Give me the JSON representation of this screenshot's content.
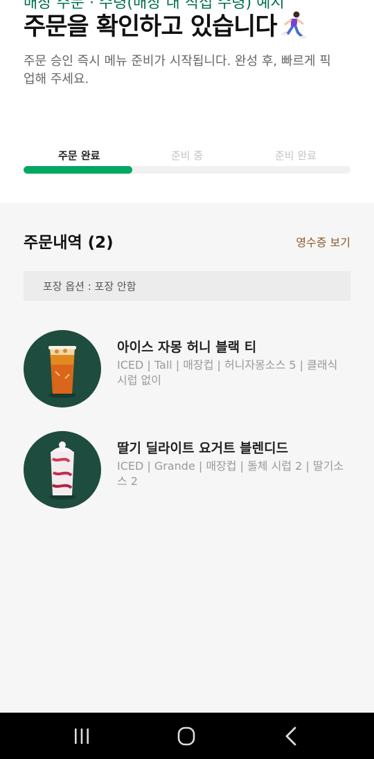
{
  "header": {
    "clipped_text": "매장 주문 · 수령(매장 내 직접 수령) 예시",
    "title": "주문을 확인하고 있습니다",
    "subtitle": "주문 승인 즉시 메뉴 준비가 시작됩니다. 완성 후, 빠르게 픽업해 주세요."
  },
  "progress": {
    "steps": [
      "주문 완료",
      "준비 중",
      "준비 완료"
    ],
    "active_index": 0,
    "fraction": 0.333,
    "accent_color": "#00a862"
  },
  "order": {
    "section_title": "주문내역 (2)",
    "receipt_link": "영수증 보기",
    "pack_option": "포장 옵션 : 포장 안함",
    "items": [
      {
        "name": "아이스 자몽 허니 블랙 티",
        "options": "ICED | Tall | 매장컵 | 허니자몽소스 5 | 클래식 시럽 없이",
        "icon": "iced-grapefruit-tea-image"
      },
      {
        "name": "딸기 딜라이트 요거트 블렌디드",
        "options": "ICED | Grande | 매장컵 | 돌체 시럽 2 | 딸기소스 2",
        "icon": "strawberry-yogurt-blended-image"
      }
    ]
  },
  "system_nav": {
    "buttons": [
      "recent-apps-icon",
      "home-icon",
      "back-icon"
    ]
  }
}
